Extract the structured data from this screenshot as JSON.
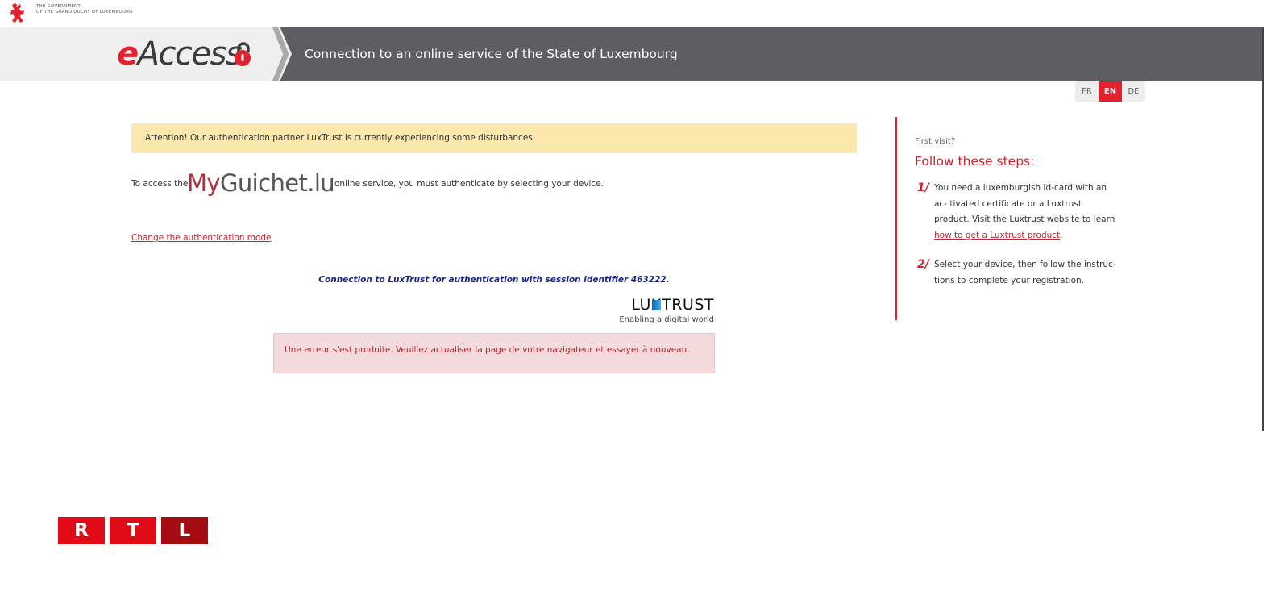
{
  "gov": {
    "line1": "THE GOVERNMENT",
    "line2": "OF THE GRAND DUCHY OF LUXEMBOURG"
  },
  "header": {
    "logo_e": "e",
    "logo_rest": "Access",
    "title": "Connection to an online service of the State of Luxembourg"
  },
  "languages": {
    "fr": "FR",
    "en": "EN",
    "de": "DE",
    "selected": "EN"
  },
  "alert": {
    "text": "Attention! Our authentication partner LuxTrust is currently experiencing some disturbances."
  },
  "access": {
    "pre": "To access the",
    "brand_my": "My",
    "brand_rest": "Guichet.lu",
    "post": "online service, you must authenticate by selecting your device."
  },
  "change_link": "Change the authentication mode",
  "session": {
    "text": "Connection to LuxTrust for authentication with session identifier 463222."
  },
  "luxtrust": {
    "word": "LUXTRUST",
    "tagline": "Enabling a digital world"
  },
  "error": {
    "text": "Une erreur s'est produite. Veuillez actualiser la page de votre navigateur et essayer à nouveau."
  },
  "sidebar": {
    "first_visit": "First visit?",
    "title": "Follow these steps:",
    "step1": {
      "num": "1/",
      "text_before": "You need a luxemburgish Id-card with an ac- tivated certificate or a Luxtrust product. Visit the Luxtrust website to learn ",
      "link": "how to get a Luxtrust product",
      "text_after": "."
    },
    "step2": {
      "num": "2/",
      "text": "Select your device, then follow the instruc- tions to complete your registration."
    }
  },
  "footer": {
    "rtl": [
      "R",
      "T",
      "L"
    ]
  },
  "colors": {
    "accent": "#e3212c",
    "header_bg": "#5d5e60",
    "alert_bg": "#fae8ad",
    "error_bg": "#f3dbdd",
    "session_text": "#1b2587"
  }
}
